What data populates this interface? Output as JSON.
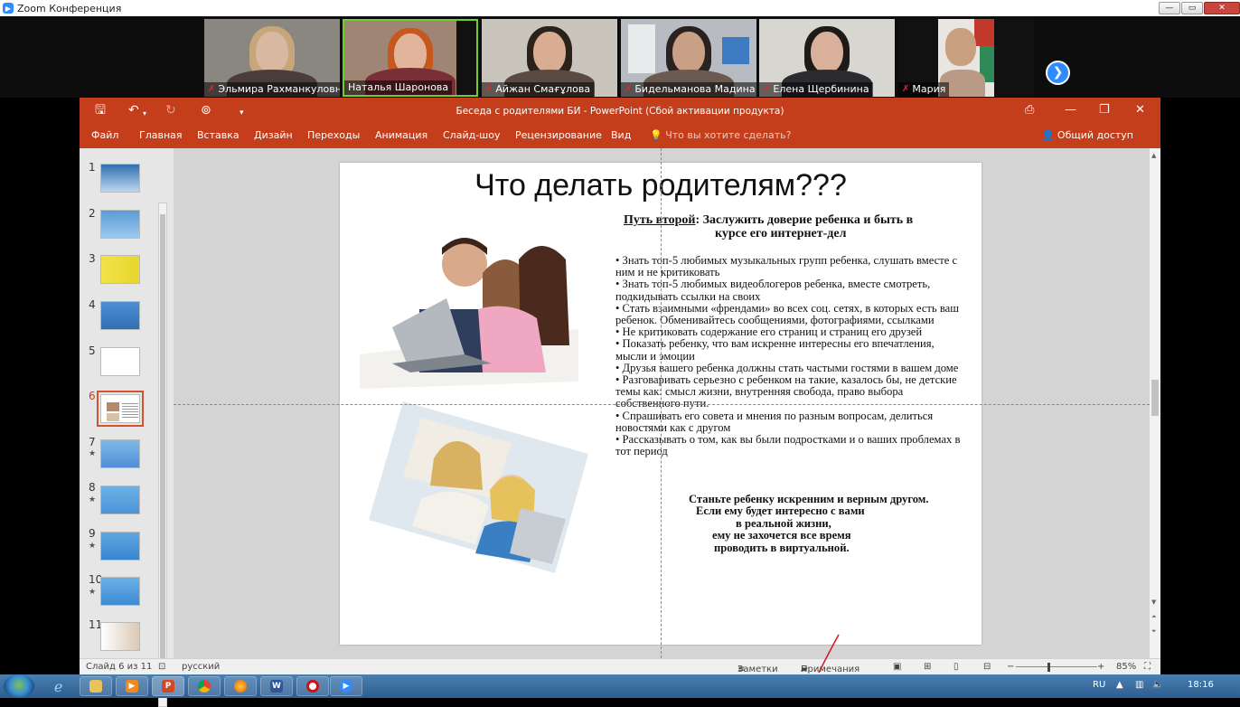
{
  "zoom": {
    "window_title": "Zoom Конференция",
    "participants": [
      {
        "name": "Эльмира Рахманкуловн...",
        "muted": true
      },
      {
        "name": "Наталья Шаронова",
        "muted": false,
        "active": true
      },
      {
        "name": "Айжан Смағұлова",
        "muted": true
      },
      {
        "name": "Бидельманова Мадина",
        "muted": true
      },
      {
        "name": "Елена Щербинина",
        "muted": true
      },
      {
        "name": "Мария",
        "muted": true
      }
    ],
    "colors": {
      "active_border": "#6fcf2d",
      "muted_mic": "#e0282a",
      "next_button": "#2d8cff"
    }
  },
  "ppt": {
    "doc_title": "Беседа с родителями БИ - PowerPoint (Сбой активации продукта)",
    "accent": "#c43e1c",
    "tabs": [
      "Файл",
      "Главная",
      "Вставка",
      "Дизайн",
      "Переходы",
      "Анимация",
      "Слайд-шоу",
      "Рецензирование",
      "Вид"
    ],
    "tell_me": "Что вы хотите сделать?",
    "share": "Общий доступ",
    "thumbnails": [
      {
        "num": "1",
        "starred": false
      },
      {
        "num": "2",
        "starred": false
      },
      {
        "num": "3",
        "starred": false
      },
      {
        "num": "4",
        "starred": false
      },
      {
        "num": "5",
        "starred": false
      },
      {
        "num": "6",
        "starred": false,
        "selected": true
      },
      {
        "num": "7",
        "starred": true
      },
      {
        "num": "8",
        "starred": true
      },
      {
        "num": "9",
        "starred": true
      },
      {
        "num": "10",
        "starred": true
      },
      {
        "num": "11",
        "starred": false
      }
    ],
    "status": {
      "slide_of": "Слайд 6 из 11",
      "language": "русский",
      "notes": "Заметки",
      "comments": "Примечания",
      "zoom": "85%"
    }
  },
  "slide": {
    "title": "Что делать родителям???",
    "head_label": "Путь второй",
    "head_line1": ":  Заслужить доверие ребенка и быть в",
    "head_line2": "курсе его интернет-дел",
    "bullets": [
      "• Знать топ-5 любимых музыкальных групп ребенка, слушать вместе с ним и не критиковать",
      "• Знать топ-5 любимых видеоблогеров ребенка, вместе смотреть, подкидывать ссылки на своих",
      "• Стать взаимными «френдами» во всех соц. сетях, в которых есть ваш ребенок. Обменивайтесь сообщениями, фотографиями, ссылками",
      "• Не критиковать содержание его страниц и страниц его друзей",
      "• Показать ребенку, что вам искренне интересны его впечатления, мысли и эмоции",
      "• Друзья вашего ребенка должны стать частыми гостями в вашем доме",
      "• Разговаривать серьезно с ребенком на такие, казалось бы, не детские темы как: смысл жизни, внутренняя свобода, право выбора собственного пути.",
      "• Спрашивать его совета и мнения по разным вопросам, делиться новостями как с другом",
      "• Рассказывать о том, как вы были подростками и о ваших проблемах в тот период"
    ],
    "footer": [
      "Станьте ребенку искренним и верным другом.",
      "Если ему будет интересно с вами",
      "в реальной жизни,",
      "ему не захочется все время",
      "проводить в виртуальной."
    ]
  },
  "taskbar": {
    "apps": [
      "explorer-icon",
      "media-player-icon",
      "powerpoint-icon",
      "chrome-icon",
      "firefox-icon",
      "word-icon",
      "opera-icon",
      "zoom-icon"
    ],
    "lang": "RU",
    "time": "18:16"
  }
}
